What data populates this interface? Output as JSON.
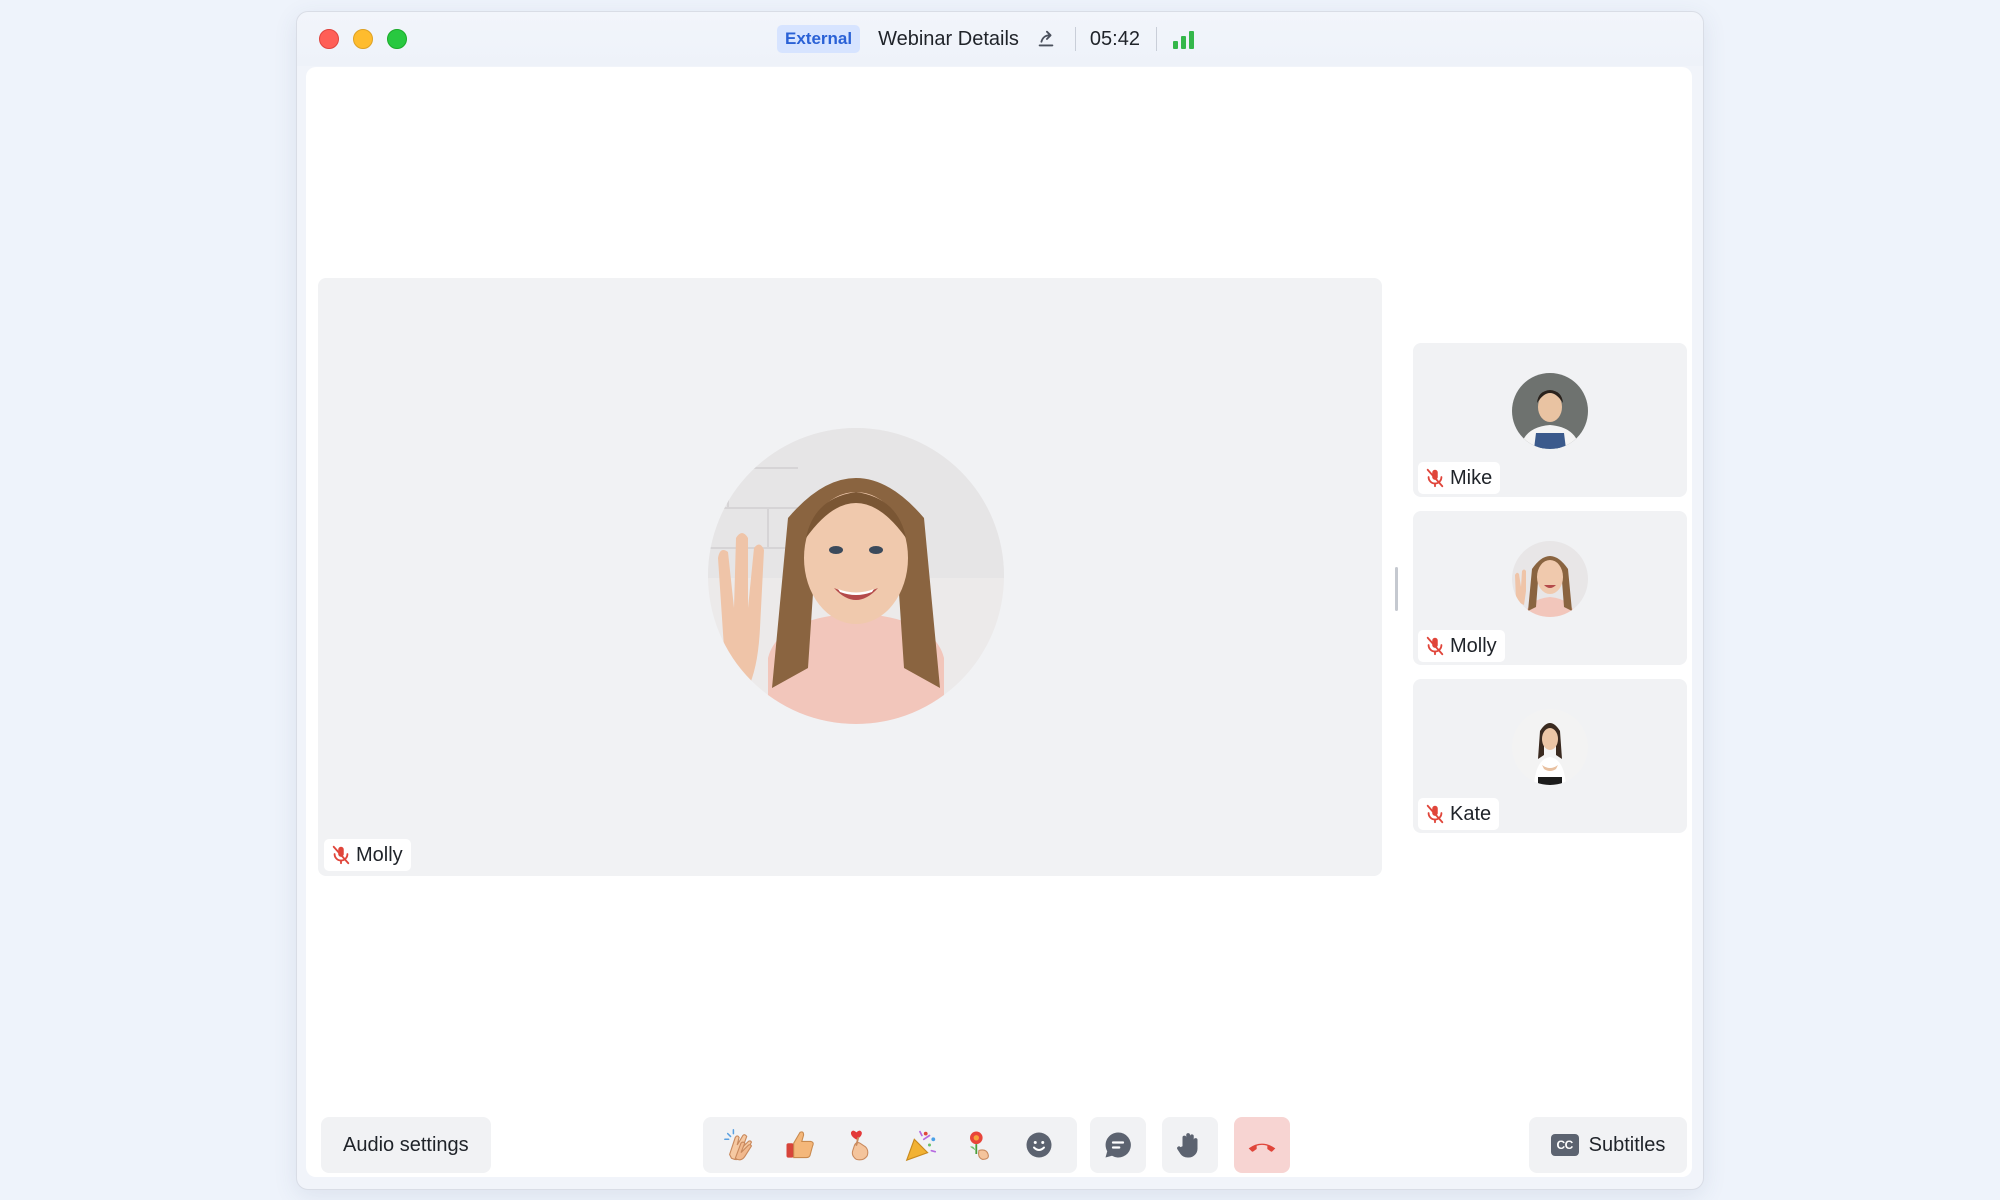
{
  "window": {
    "badge": "External",
    "title": "Webinar Details",
    "timer": "05:42"
  },
  "main_speaker": {
    "name": "Molly",
    "muted": true
  },
  "participants": [
    {
      "name": "Mike",
      "muted": true
    },
    {
      "name": "Molly",
      "muted": true
    },
    {
      "name": "Kate",
      "muted": true
    }
  ],
  "toolbar": {
    "audio_settings_label": "Audio settings",
    "reactions": [
      "clapping-hands-icon",
      "thumbs-up-icon",
      "finger-heart-icon",
      "party-popper-icon",
      "bouquet-icon",
      "emoji-icon"
    ],
    "chat_icon": "chat-icon",
    "hand_icon": "raise-hand-icon",
    "leave_icon": "hang-up-icon",
    "subtitles_label": "Subtitles",
    "subtitles_icon_text": "CC"
  },
  "colors": {
    "accent_badge_bg": "#d7e4ff",
    "accent_badge_text": "#2a61d6",
    "mic_muted": "#e0453a",
    "leave_bg": "#f7d4d2",
    "signal": "#34b74a"
  }
}
